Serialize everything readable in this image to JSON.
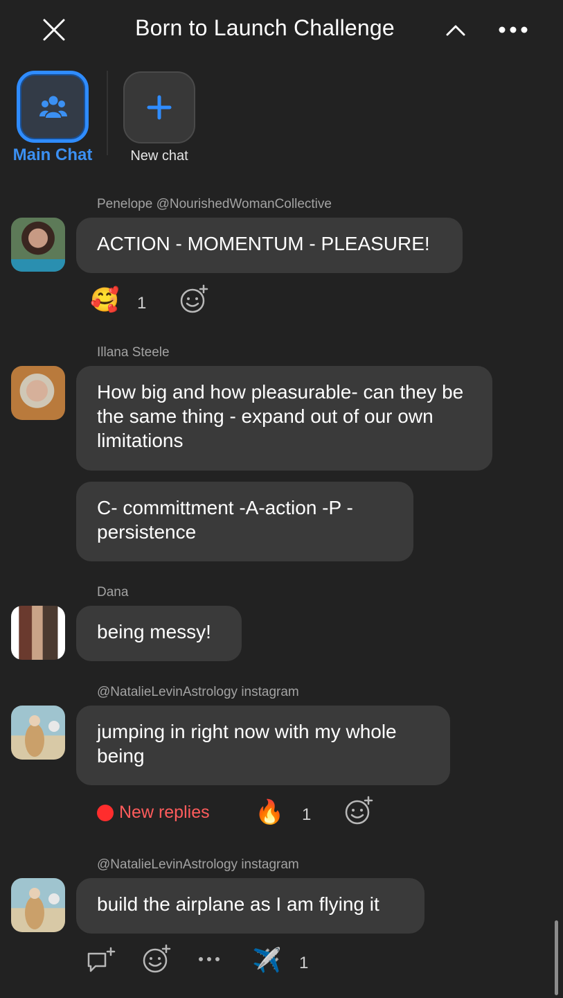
{
  "header": {
    "title": "Born to Launch Challenge",
    "close_icon": "close-icon",
    "collapse_icon": "chevron-up-icon",
    "more_icon": "more-horizontal-icon"
  },
  "tabs": {
    "main": {
      "label": "Main Chat",
      "icon": "group-icon",
      "active": true,
      "accent": "#2f8cff"
    },
    "new": {
      "label": "New chat",
      "icon": "plus-icon"
    }
  },
  "messages": [
    {
      "sender": "Penelope @NourishedWomanCollective",
      "bubbles": [
        "ACTION - MOMENTUM - PLEASURE!"
      ],
      "reactions": [
        {
          "emoji": "🥰",
          "count": "1"
        }
      ]
    },
    {
      "sender": "Illana Steele",
      "bubbles": [
        "How big and how pleasurable- can they be the same thing - expand out of our own limitations",
        "C- committment -A-action -P - persistence"
      ]
    },
    {
      "sender": "Dana",
      "bubbles": [
        "being messy!"
      ]
    },
    {
      "sender": "@NatalieLevinAstrology instagram",
      "bubbles": [
        "jumping in right now with my whole being"
      ],
      "new_replies": "New replies",
      "reactions": [
        {
          "emoji": "🔥",
          "count": "1"
        }
      ]
    },
    {
      "sender": "@NatalieLevinAstrology instagram",
      "bubbles": [
        "build the airplane as I am flying it"
      ],
      "reactions": [
        {
          "emoji": "✈️",
          "count": "1"
        }
      ]
    }
  ],
  "colors": {
    "background": "#222222",
    "bubble": "#3a3a3a",
    "accent": "#2f8cff",
    "alert": "#ff2d2d"
  }
}
